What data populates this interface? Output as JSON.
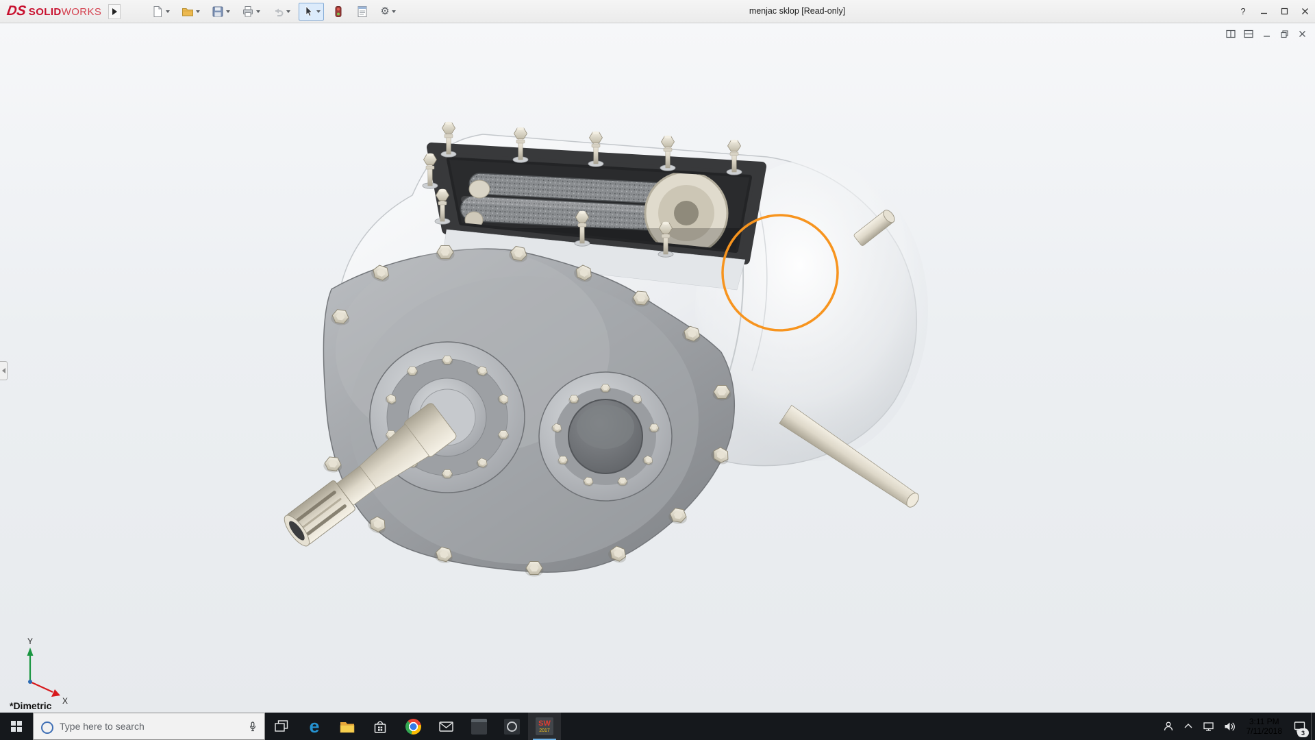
{
  "titlebar": {
    "logo": {
      "ds": "DS",
      "solid": "SOLID",
      "works": "WORKS"
    },
    "document_title": "menjac sklop [Read-only]",
    "help_glyph": "?",
    "options_gear_glyph": "⚙",
    "toolbar_items": [
      "new-document",
      "open",
      "save",
      "print",
      "undo",
      "select",
      "rebuild",
      "file-properties",
      "options"
    ]
  },
  "document_controls": [
    "split-pane-vertical",
    "split-pane-horizontal",
    "minimize-document",
    "restore-document",
    "close-document"
  ],
  "viewport": {
    "view_orientation_label": "*Dimetric",
    "triad": {
      "x_label": "X",
      "y_label": "Y"
    },
    "annotation_circle_color": "#F7941E"
  },
  "taskbar": {
    "search_placeholder": "Type here to search",
    "pinned_apps": [
      "task-view",
      "microsoft-edge",
      "file-explorer",
      "microsoft-store",
      "chrome",
      "mail",
      "pinned-app-1",
      "pinned-app-2",
      "solidworks-2017"
    ],
    "edge_glyph": "e",
    "solidworks_icon": {
      "letters": "SW",
      "year": "2017"
    },
    "tray": {
      "time": "3:11 PM",
      "date": "7/11/2018",
      "notification_badge": "3"
    }
  }
}
